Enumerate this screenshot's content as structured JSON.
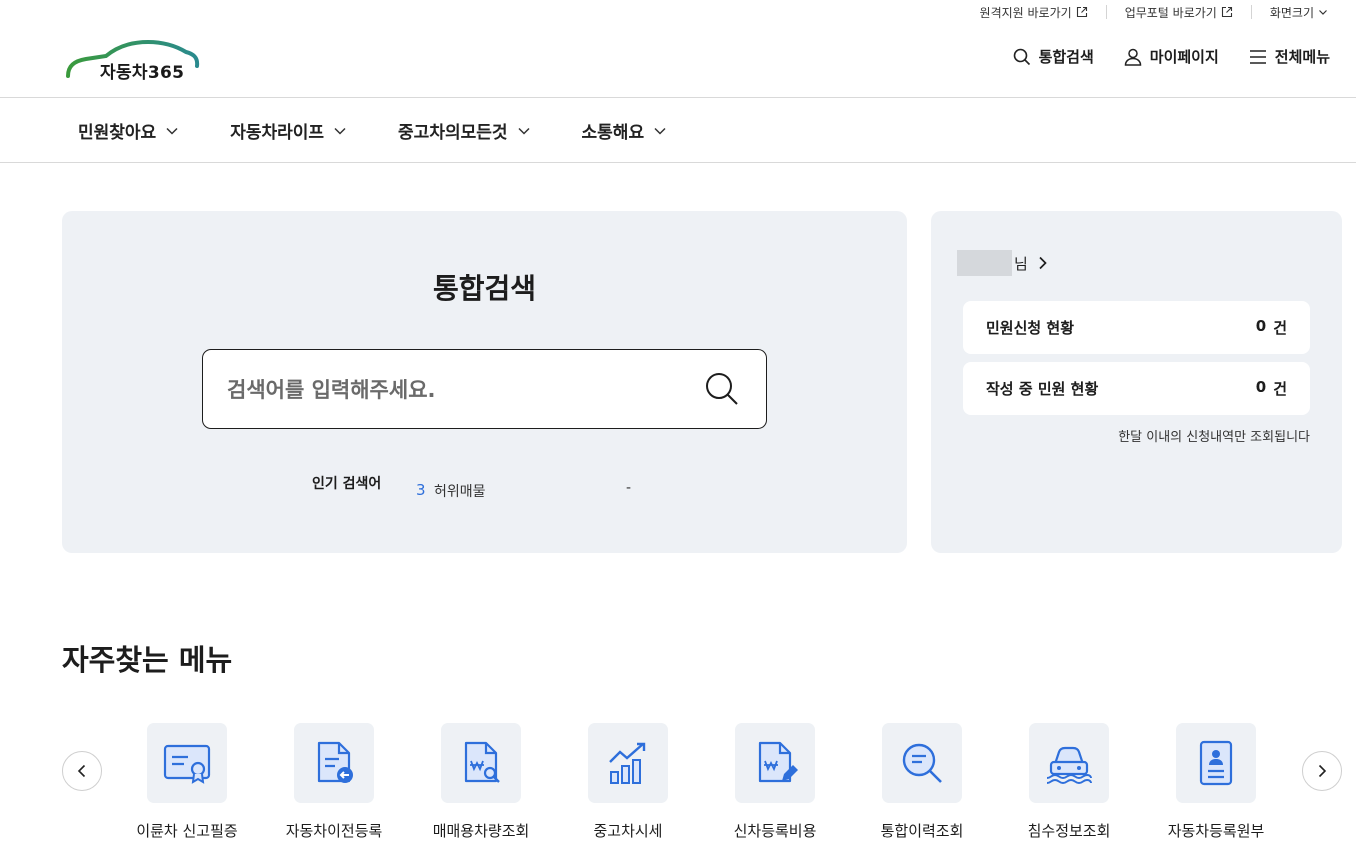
{
  "utility": {
    "remote_support": "원격지원 바로가기",
    "work_portal": "업무포털 바로가기",
    "screen_size": "화면크기"
  },
  "header": {
    "logo_text": "자동차365",
    "search": "통합검색",
    "mypage": "마이페이지",
    "all_menu": "전체메뉴"
  },
  "gnb": [
    {
      "label": "민원찾아요"
    },
    {
      "label": "자동차라이프"
    },
    {
      "label": "중고차의모든것"
    },
    {
      "label": "소통해요"
    }
  ],
  "search_panel": {
    "title": "통합검색",
    "placeholder": "검색어를 입력해주세요.",
    "value": "",
    "popular_label": "인기 검색어",
    "popular_rank": "3",
    "popular_term": "허위매물",
    "popular_trend": "-"
  },
  "user_panel": {
    "name_suffix": "님",
    "stats": [
      {
        "label": "민원신청 현황",
        "count": "0",
        "unit": "건"
      },
      {
        "label": "작성 중 민원 현황",
        "count": "0",
        "unit": "건"
      }
    ],
    "note": "한달 이내의 신청내역만 조회됩니다"
  },
  "frequent": {
    "title": "자주찾는 메뉴",
    "items": [
      {
        "label": "이륜차 신고필증",
        "icon": "certificate-icon"
      },
      {
        "label": "자동차이전등록",
        "icon": "document-transfer-icon"
      },
      {
        "label": "매매용차량조회",
        "icon": "document-search-icon"
      },
      {
        "label": "중고차시세",
        "icon": "chart-trend-icon"
      },
      {
        "label": "신차등록비용",
        "icon": "document-pen-icon"
      },
      {
        "label": "통합이력조회",
        "icon": "magnifier-list-icon"
      },
      {
        "label": "침수정보조회",
        "icon": "flooded-car-icon"
      },
      {
        "label": "자동차등록원부",
        "icon": "registration-card-icon"
      }
    ]
  },
  "colors": {
    "accent_blue": "#2e6fdb",
    "panel_bg": "#eef1f5",
    "logo_green": "#3a9a3c",
    "logo_teal": "#2a8a8e"
  }
}
